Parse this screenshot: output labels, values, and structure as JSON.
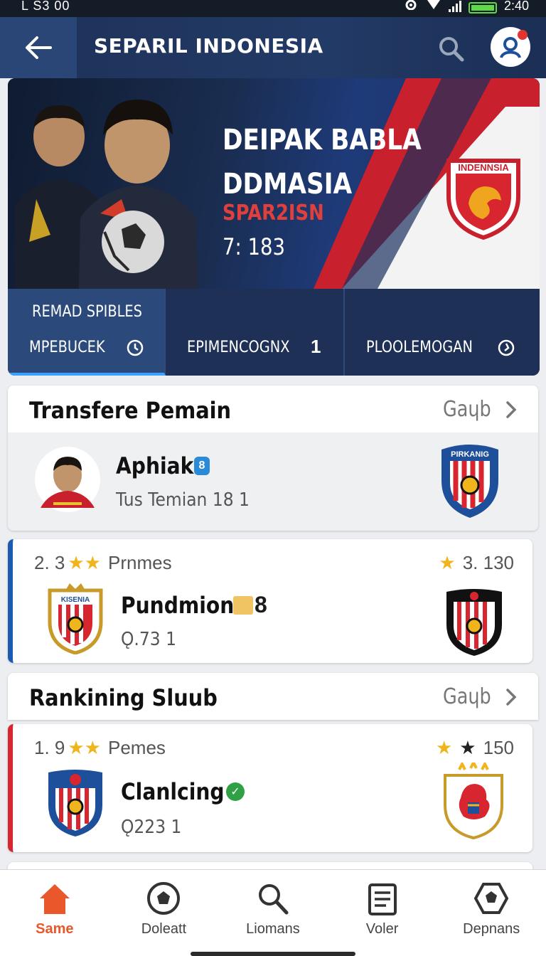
{
  "status_bar": {
    "left_text": "L S3 00",
    "time": "2:40"
  },
  "app_bar": {
    "title": "SEPARIL INDONESIA"
  },
  "hero": {
    "headline_line1": "DEIPAK BABLA",
    "headline_line2": "DDMASIA",
    "subtitle": "SPAR2ISN",
    "score": "7: 183",
    "crest_text": "INDENNSIA",
    "stats": {
      "top_label": "REMAD SPIBLES",
      "cell1_label": "MPEBUCEK",
      "cell2_label": "EPIMENCOGNX",
      "cell2_value": "1",
      "cell3_label": "PLOOLEMOGAN"
    }
  },
  "transfer_section": {
    "title": "Transfere Pemain",
    "see_all": "Gaɥb",
    "player": {
      "name": "Aphiak",
      "badge": "8",
      "subtitle": "Tus Temian 18 1",
      "club_badge_text": "PIRKANIG"
    }
  },
  "match_card": {
    "rank": "2. 3",
    "label": "Prnmes",
    "right_value": "3. 130",
    "name": "Pundmion",
    "name_suffix": "8",
    "sub": "Ǫ.73 1",
    "left_badge_text": "KISENIA"
  },
  "ranking_section": {
    "title": "Rankining Sluub",
    "see_all": "Gaɥb"
  },
  "ranking_card": {
    "rank": "1. 9",
    "label": "Pemes",
    "right_value": "150",
    "name": "Clanlcing",
    "sub": "Ǫ223 1"
  },
  "bottom_nav": [
    {
      "label": "Same",
      "icon": "home-icon",
      "active": true
    },
    {
      "label": "Doleatt",
      "icon": "soccer-ball-icon",
      "active": false
    },
    {
      "label": "Liomans",
      "icon": "search-icon",
      "active": false
    },
    {
      "label": "Voler",
      "icon": "clipboard-icon",
      "active": false
    },
    {
      "label": "Depnans",
      "icon": "ball-badge-icon",
      "active": false
    }
  ],
  "colors": {
    "accent": "#e9582b",
    "navy": "#1e3258",
    "red": "#d7262f",
    "blue_indicator": "#1a5ab0"
  }
}
